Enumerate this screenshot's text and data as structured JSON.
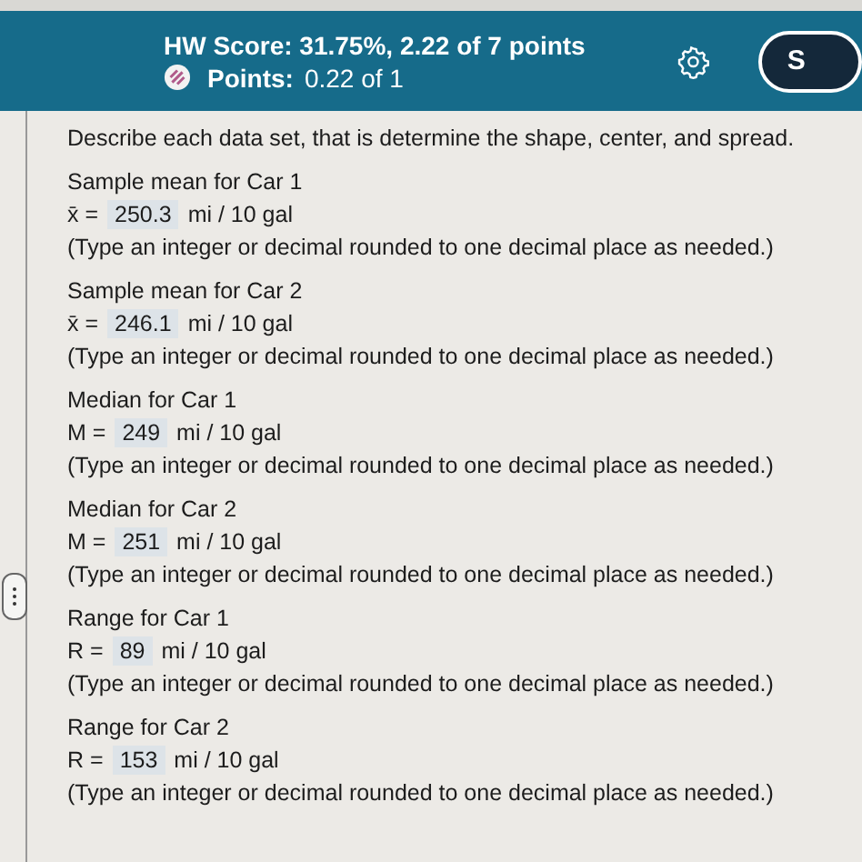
{
  "header": {
    "score": "HW Score: 31.75%, 2.22 of 7 points",
    "points_label": "Points:",
    "points_value": "0.22 of 1",
    "button": "S"
  },
  "instructions": "Describe each data set, that is determine the shape, center, and spread.",
  "answers": [
    {
      "title": "Sample mean for Car 1",
      "symbol": "x̄ =",
      "value": "250.3",
      "unit": "mi / 10 gal",
      "hint": "(Type an integer or decimal rounded to one decimal place as needed.)"
    },
    {
      "title": "Sample mean for Car 2",
      "symbol": "x̄ =",
      "value": "246.1",
      "unit": "mi / 10 gal",
      "hint": "(Type an integer or decimal rounded to one decimal place as needed.)"
    },
    {
      "title": "Median for Car 1",
      "symbol": "M =",
      "value": "249",
      "unit": "mi / 10 gal",
      "hint": "(Type an integer or decimal rounded to one decimal place as needed.)"
    },
    {
      "title": "Median for Car 2",
      "symbol": "M =",
      "value": "251",
      "unit": "mi / 10 gal",
      "hint": "(Type an integer or decimal rounded to one decimal place as needed.)"
    },
    {
      "title": "Range for Car 1",
      "symbol": "R =",
      "value": "89",
      "unit": "mi / 10 gal",
      "hint": "(Type an integer or decimal rounded to one decimal place as needed.)"
    },
    {
      "title": "Range for Car 2",
      "symbol": "R =",
      "value": "153",
      "unit": "mi / 10 gal",
      "hint": "(Type an integer or decimal rounded to one decimal place as needed.)"
    }
  ]
}
